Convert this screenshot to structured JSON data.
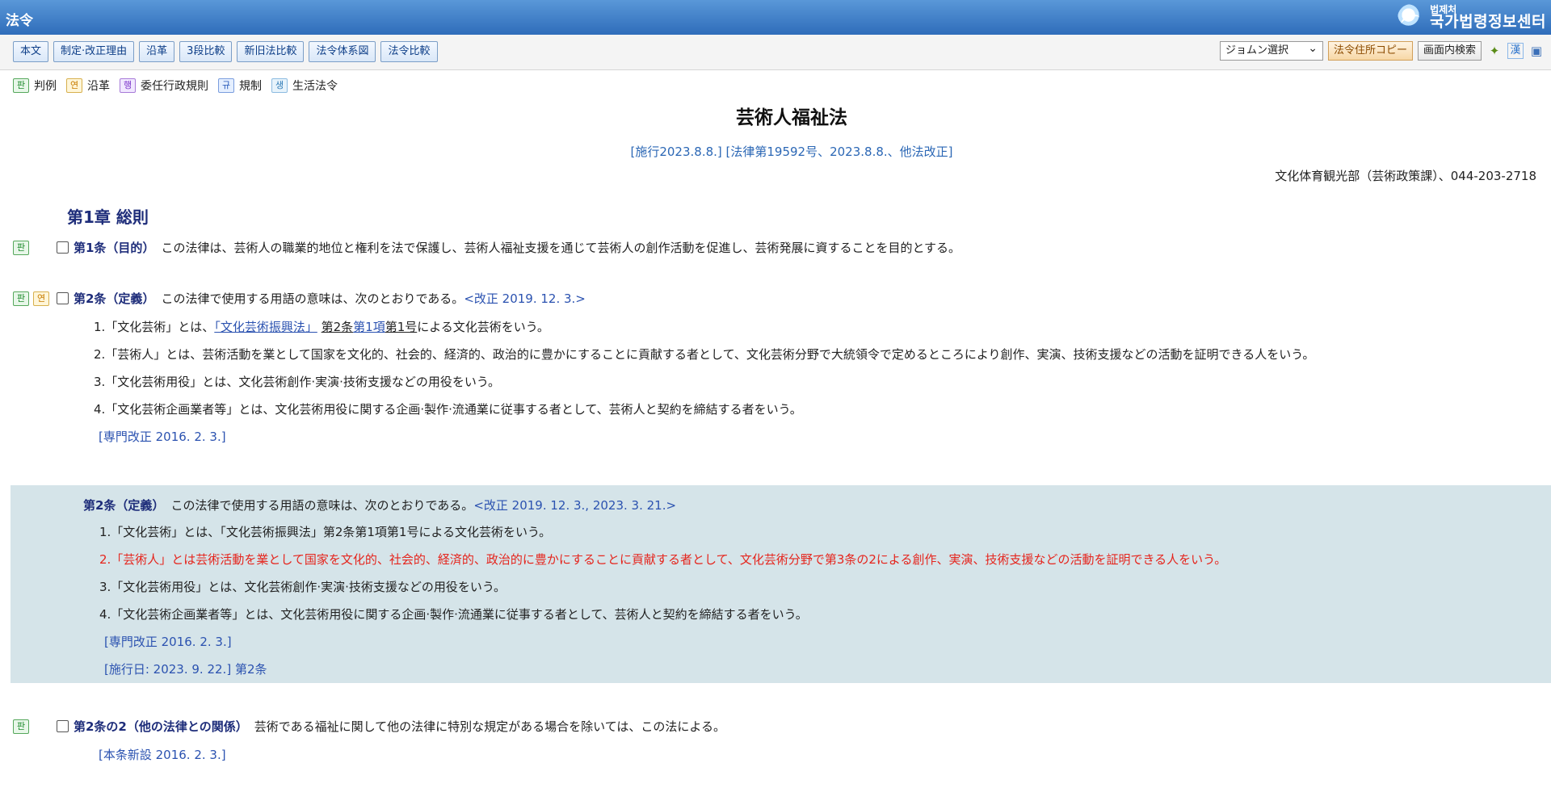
{
  "app_title": "法令",
  "logo": {
    "small": "법제처",
    "big": "국가법령정보센터"
  },
  "toolbar": {
    "buttons": [
      "本文",
      "制定·改正理由",
      "沿革",
      "3段比較",
      "新旧法比較",
      "法令体系図",
      "法令比較"
    ],
    "select_value": "ジョムン選択",
    "copy_address": "法令住所コピー",
    "page_search": "画面内検索",
    "icons": [
      "star-icon",
      "hanja-icon",
      "save-icon"
    ]
  },
  "legend": [
    {
      "badge": "판",
      "label": "判例"
    },
    {
      "badge": "연",
      "label": "沿革"
    },
    {
      "badge": "행",
      "label": "委任行政規則"
    },
    {
      "badge": "규",
      "label": "規制"
    },
    {
      "badge": "생",
      "label": "生活法令"
    }
  ],
  "law": {
    "title": "芸術人福祉法",
    "info": "[施行2023.8.8.] [法律第19592号、2023.8.8.、他法改正]",
    "dept": "文化体育観光部（芸術政策課）、044-203-2718"
  },
  "chapter": "第1章 総則",
  "article1": {
    "badges": [
      "판"
    ],
    "head": "第1条（目的）",
    "text": "この法律は、芸術人の職業的地位と権利を法で保護し、芸術人福祉支援を通じて芸術人の創作活動を促進し、芸術発展に資することを目的とする。"
  },
  "article2": {
    "badges": [
      "판",
      "연"
    ],
    "head": "第2条（定義）",
    "text": "この法律で使用する用語の意味は、次のとおりである。",
    "amend": "<改正 2019. 12. 3.>",
    "item1_prefix": "1.「文化芸術」とは、",
    "item1_link": "「文化芸術振興法」",
    "item1_ref1": "第2条",
    "item1_ref2": "第1項",
    "item1_ref3": "第1号",
    "item1_suffix": "による文化芸術をいう。",
    "item2": "2.「芸術人」とは、芸術活動を業として国家を文化的、社会的、経済的、政治的に豊かにすることに貢献する者として、文化芸術分野で大統領令で定めるところにより創作、実演、技術支援などの活動を証明できる人をいう。",
    "item3": "3.「文化芸術用役」とは、文化芸術創作·実演·技術支援などの用役をいう。",
    "item4": "4.「文化芸術企画業者等」とは、文化芸術用役に関する企画·製作·流通業に従事する者として、芸術人と契約を締結する者をいう。",
    "note": "[専門改正 2016. 2. 3.]"
  },
  "article2_new": {
    "head": "第2条（定義）",
    "text": "この法律で使用する用語の意味は、次のとおりである。",
    "amend": "<改正 2019. 12. 3., 2023. 3. 21.>",
    "item1": "1.「文化芸術」とは、「文化芸術振興法」第2条第1項第1号による文化芸術をいう。",
    "item2": "2.「芸術人」とは芸術活動を業として国家を文化的、社会的、経済的、政治的に豊かにすることに貢献する者として、文化芸術分野で第3条の2による創作、実演、技術支援などの活動を証明できる人をいう。",
    "item3": "3.「文化芸術用役」とは、文化芸術創作·実演·技術支援などの用役をいう。",
    "item4": "4.「文化芸術企画業者等」とは、文化芸術用役に関する企画·製作·流通業に従事する者として、芸術人と契約を締結する者をいう。",
    "note1": "[専門改正 2016. 2. 3.]",
    "note2": "[施行日: 2023. 9. 22.] 第2条"
  },
  "article2_2": {
    "badges": [
      "판"
    ],
    "head": "第2条の2（他の法律との関係）",
    "text": "芸術である福祉に関して他の法律に特別な規定がある場合を除いては、この法による。",
    "note": "[本条新設 2016. 2. 3.]"
  }
}
